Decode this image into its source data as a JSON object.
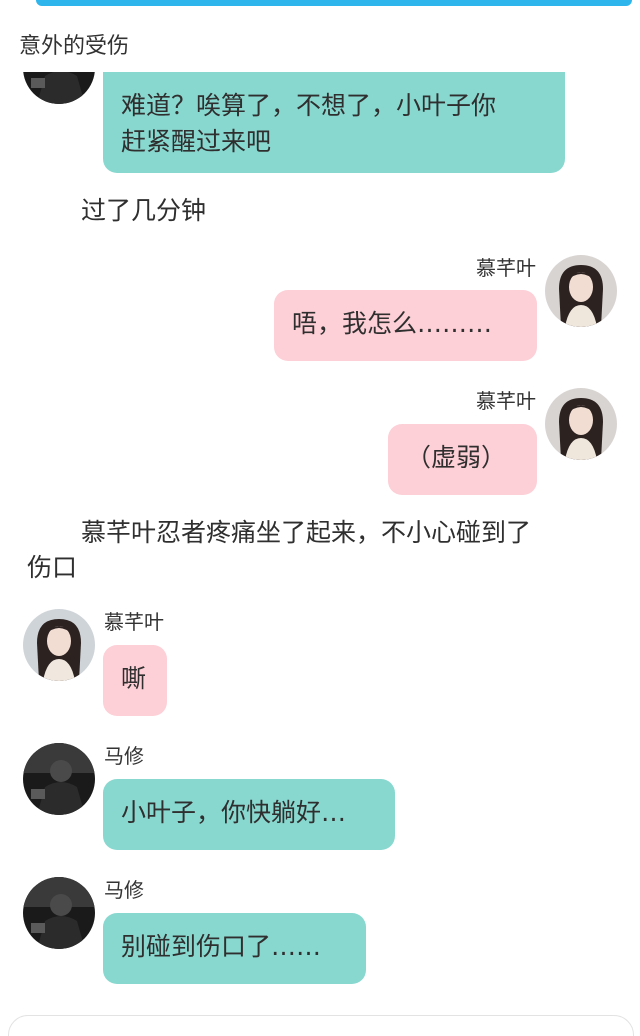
{
  "chapter_title": "意外的受伤",
  "messages": [
    {
      "speaker": "",
      "text": "难道？唉算了，不想了，小叶子你赶紧醒过来吧",
      "line1": "难道？唉算了，不想了，小叶子你",
      "line2": "赶紧醒过来吧",
      "side": "left",
      "color": "teal"
    },
    {
      "type": "narration",
      "text": "过了几分钟"
    },
    {
      "speaker": "慕芊叶",
      "text": "唔，我怎么………",
      "side": "right",
      "color": "pink"
    },
    {
      "speaker": "慕芊叶",
      "text": "（虚弱）",
      "side": "right",
      "color": "pink"
    },
    {
      "type": "narration",
      "text": "慕芊叶忍者疼痛坐了起来，不小心碰到了伤口",
      "line1": "慕芊叶忍者疼痛坐了起来，不小心碰到了",
      "line2": "伤口"
    },
    {
      "speaker": "慕芊叶",
      "text": "嘶",
      "side": "left",
      "color": "pink"
    },
    {
      "speaker": "马修",
      "text": "小叶子，你快躺好…",
      "side": "left",
      "color": "teal"
    },
    {
      "speaker": "马修",
      "text": "别碰到伤口了……",
      "side": "left",
      "color": "teal"
    }
  ],
  "colors": {
    "accent_strip": "#2db5ec",
    "teal_bubble": "#89d8d0",
    "pink_bubble": "#fdcfd6",
    "text": "#2f2f2f"
  },
  "icons": {
    "avatar_girl": "girl-portrait-avatar",
    "avatar_matthew": "dark-figure-avatar"
  }
}
